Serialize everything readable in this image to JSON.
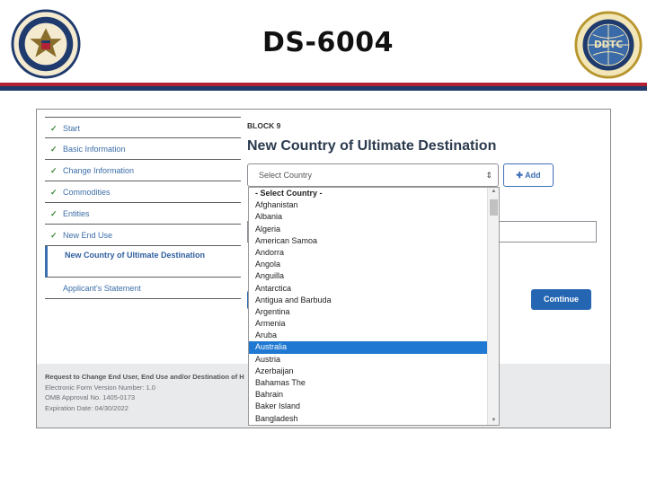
{
  "slide": {
    "title": "DS-6004"
  },
  "seals": {
    "left": "Department of State seal",
    "right": "DDTC seal",
    "right_text": "DDTC"
  },
  "nav": {
    "items": [
      {
        "label": "Start",
        "done": true
      },
      {
        "label": "Basic Information",
        "done": true
      },
      {
        "label": "Change Information",
        "done": true
      },
      {
        "label": "Commodities",
        "done": true
      },
      {
        "label": "Entities",
        "done": true
      },
      {
        "label": "New End Use",
        "done": true
      },
      {
        "label": "New Country of Ultimate Destination",
        "active": true
      },
      {
        "label": "Applicant's Statement",
        "done": false
      }
    ]
  },
  "main": {
    "block_label": "BLOCK 9",
    "heading": "New Country of Ultimate Destination",
    "select_value": "Select Country",
    "add_label": "Add",
    "continue_label": "Continue"
  },
  "dropdown": {
    "options": [
      "- Select Country -",
      "Afghanistan",
      "Albania",
      "Algeria",
      "American Samoa",
      "Andorra",
      "Angola",
      "Anguilla",
      "Antarctica",
      "Antigua and Barbuda",
      "Argentina",
      "Armenia",
      "Aruba",
      "Australia",
      "Austria",
      "Azerbaijan",
      "Bahamas The",
      "Bahrain",
      "Baker Island",
      "Bangladesh"
    ],
    "selected": "Australia"
  },
  "footer": {
    "title": "Request to Change End User, End Use and/or Destination of H",
    "version": "Electronic Form Version Number: 1.0",
    "omb": "OMB Approval No. 1405-0173",
    "expiration": "Expiration Date: 04/30/2022"
  },
  "colors": {
    "accent": "#2566b3",
    "selected": "#1f78d1",
    "check": "#3f8a3a",
    "rule_red": "#b22234",
    "rule_blue": "#1f3a6d"
  }
}
